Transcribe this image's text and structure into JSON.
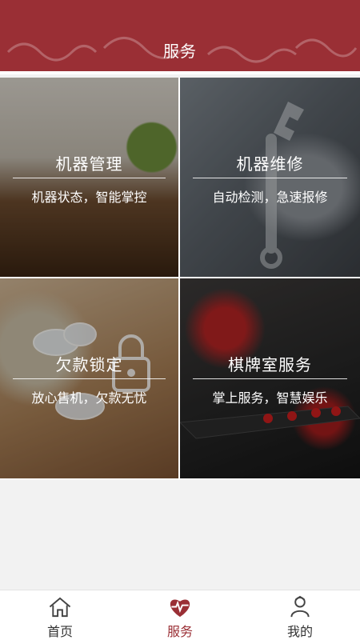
{
  "header": {
    "title": "服务"
  },
  "tiles": [
    {
      "title": "机器管理",
      "subtitle": "机器状态，智能掌控"
    },
    {
      "title": "机器维修",
      "subtitle": "自动检测，急速报修"
    },
    {
      "title": "欠款锁定",
      "subtitle": "放心售机，欠款无忧"
    },
    {
      "title": "棋牌室服务",
      "subtitle": "掌上服务，智慧娱乐"
    }
  ],
  "bottom_nav": {
    "items": [
      {
        "label": "首页",
        "icon": "home-icon"
      },
      {
        "label": "服务",
        "icon": "heart-pulse-icon",
        "active": true
      },
      {
        "label": "我的",
        "icon": "profile-icon"
      }
    ]
  },
  "colors": {
    "brand": "#9a2f35",
    "text": "#333333",
    "background": "#f2f2f2"
  }
}
